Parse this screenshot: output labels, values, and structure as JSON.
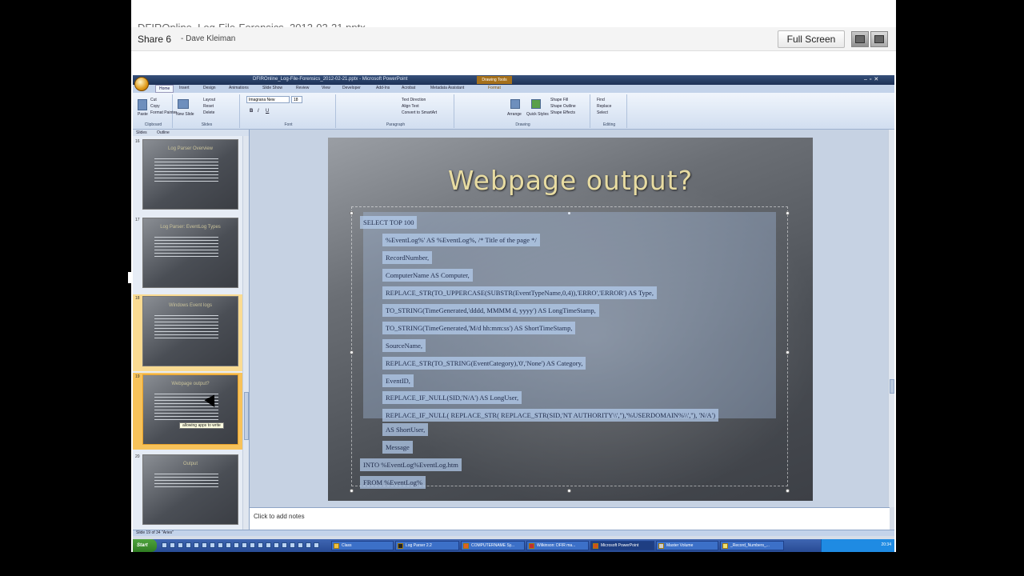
{
  "webinar": {
    "leaked_title": "DFIROnline_Log-File-Forensics_2012-02-21.pptx",
    "share_title": "Share 6",
    "share_owner": "- Dave Kleiman",
    "fullscreen_label": "Full Screen"
  },
  "ppt": {
    "window_title": "DFIROnline_Log-File-Forensics_2012-02-21.pptx - Microsoft PowerPoint",
    "contextual_tab": "Drawing Tools",
    "ribbon_tabs": [
      "Home",
      "Insert",
      "Design",
      "Animations",
      "Slide Show",
      "Review",
      "View",
      "Developer",
      "Add-Ins",
      "Acrobat",
      "Metadata Assistant",
      "Format"
    ],
    "font_name": "Imagrana New",
    "font_size": "18",
    "clipboard": {
      "paste": "Paste",
      "cut": "Cut",
      "copy": "Copy",
      "format_painter": "Format Painter",
      "label": "Clipboard"
    },
    "slides_group": {
      "new_slide": "New Slide",
      "layout": "Layout",
      "reset": "Reset",
      "delete": "Delete",
      "label": "Slides"
    },
    "font_label": "Font",
    "paragraph": {
      "text_direction": "Text Direction",
      "align_text": "Align Text",
      "convert": "Convert to SmartArt",
      "label": "Paragraph"
    },
    "drawing": {
      "arrange": "Arrange",
      "quick_styles": "Quick Styles",
      "shape_fill": "Shape Fill",
      "shape_outline": "Shape Outline",
      "shape_effects": "Shape Effects",
      "label": "Drawing"
    },
    "editing": {
      "find": "Find",
      "replace": "Replace",
      "select": "Select",
      "label": "Editing"
    },
    "pane_tabs": [
      "Slides",
      "Outline"
    ],
    "thumbnails": [
      {
        "num": "16",
        "title": "Log Parser Overview"
      },
      {
        "num": "17",
        "title": "Log Parser: EventLog Types"
      },
      {
        "num": "18",
        "title": "Windows Event logs"
      },
      {
        "num": "19",
        "title": "Webpage output?",
        "tooltip": "allowing apps to write"
      },
      {
        "num": "20",
        "title": "Output"
      }
    ],
    "slide": {
      "title": "Webpage output?",
      "lines": [
        "SELECT TOP 100",
        "%EventLog%' AS %EventLog%, /* Title of the page */",
        "RecordNumber,",
        "ComputerName  AS Computer,",
        "REPLACE_STR(TO_UPPERCASE(SUBSTR(EventTypeName,0,4)),'ERRO','ERROR')  AS Type,",
        "TO_STRING(TimeGenerated,'dddd, MMMM d, yyyy') AS LongTimeStamp,",
        "TO_STRING(TimeGenerated,'M/d hh:mm:ss') AS ShortTimeStamp,",
        "SourceName,",
        "REPLACE_STR(TO_STRING(EventCategory),'0','None') AS Category,",
        "EventID,",
        "REPLACE_IF_NULL(SID,'N/A') AS LongUser,",
        "REPLACE_IF_NULL( REPLACE_STR( REPLACE_STR(SID,'NT AUTHORITY\\\\',''),'%USERDOMAIN%\\\\',''), 'N/A')",
        "AS ShortUser,",
        "Message",
        "INTO %EventLog%EventLog.htm",
        "FROM %EventLog%"
      ]
    },
    "notes_placeholder": "Click to add notes",
    "status": "Slide 19 of 34    \"Aries\"",
    "taskbar": {
      "start": "Start",
      "tasks": [
        "Class",
        "Log Parser 2.2",
        "COMPUTERNAME Sy...",
        "Wilkinson: DFIR ma...",
        "Microsoft PowerPoint",
        "Master Volume",
        "_Record_Numbers_..."
      ],
      "clock": "20:34"
    }
  }
}
